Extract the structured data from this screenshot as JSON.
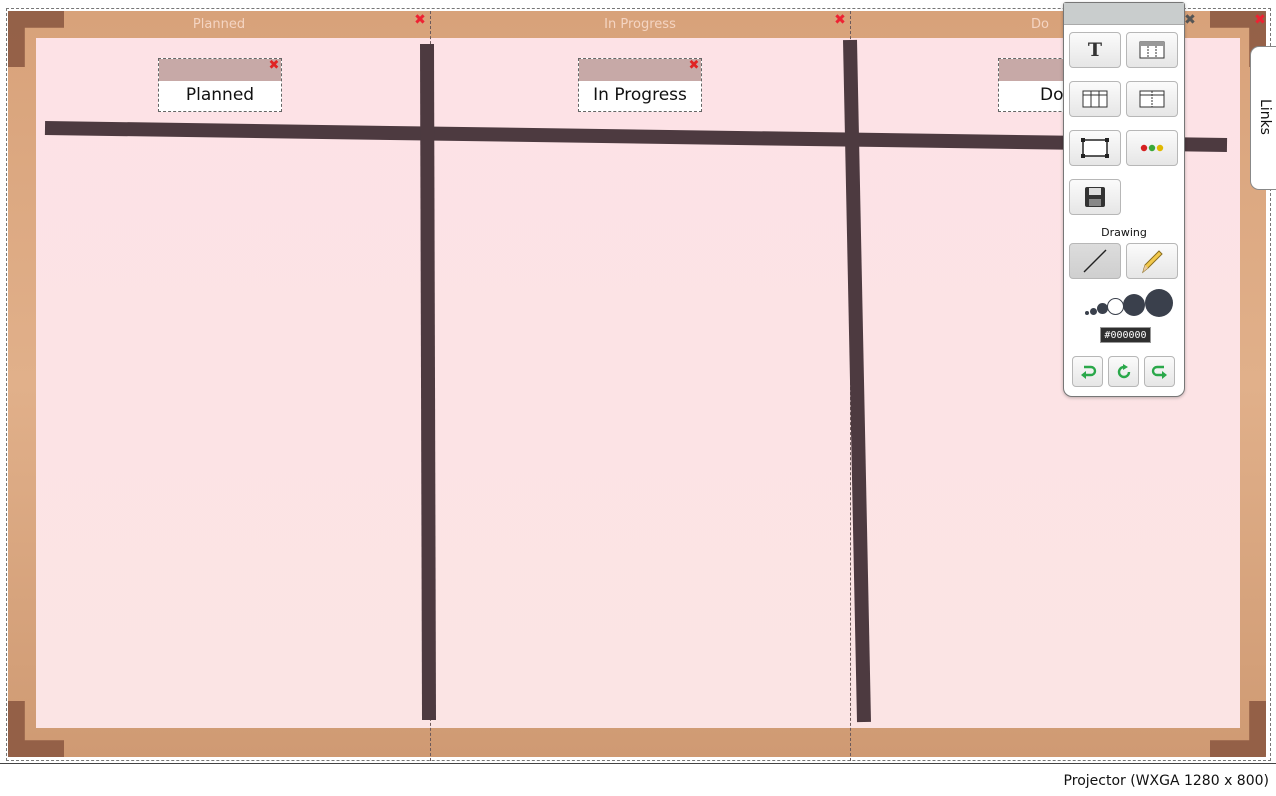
{
  "board": {
    "columns": [
      {
        "header": "Planned",
        "card_label": "Planned"
      },
      {
        "header": "In Progress",
        "card_label": "In Progress"
      },
      {
        "header": "Do",
        "card_label": "Do"
      }
    ],
    "delete_glyph": "✖"
  },
  "toolbar": {
    "buttons": [
      {
        "name": "text-tool-button",
        "icon": "text-icon",
        "glyph": "T"
      },
      {
        "name": "card-template-button",
        "icon": "card-template-icon"
      },
      {
        "name": "three-columns-button",
        "icon": "three-columns-icon"
      },
      {
        "name": "two-columns-button",
        "icon": "two-columns-icon"
      },
      {
        "name": "rectangle-button",
        "icon": "rectangle-icon"
      },
      {
        "name": "traffic-light-button",
        "icon": "traffic-light-icon"
      },
      {
        "name": "save-button",
        "icon": "floppy-disk-icon"
      }
    ],
    "drawing_label": "Drawing",
    "drawing_tools": [
      {
        "name": "line-tool-button",
        "icon": "line-icon",
        "active": true
      },
      {
        "name": "pencil-tool-button",
        "icon": "pencil-icon",
        "active": false
      }
    ],
    "brush_sizes": [
      "extra-small",
      "small",
      "medium",
      "large",
      "extra-large",
      "huge"
    ],
    "selected_color": "#000000",
    "history_buttons": [
      {
        "name": "undo-button",
        "icon": "undo-icon"
      },
      {
        "name": "refresh-button",
        "icon": "refresh-icon"
      },
      {
        "name": "redo-button",
        "icon": "redo-icon"
      }
    ]
  },
  "links_tab": {
    "label": "Links"
  },
  "status_bar": {
    "projector": "Projector (WXGA 1280 x 800)"
  },
  "colors": {
    "frame": "#d8a27a",
    "surface": "#fde2e6",
    "drawn_line": "#4d3a40",
    "delete_red": "#e02323",
    "card_bar": "#c7a9a7"
  }
}
